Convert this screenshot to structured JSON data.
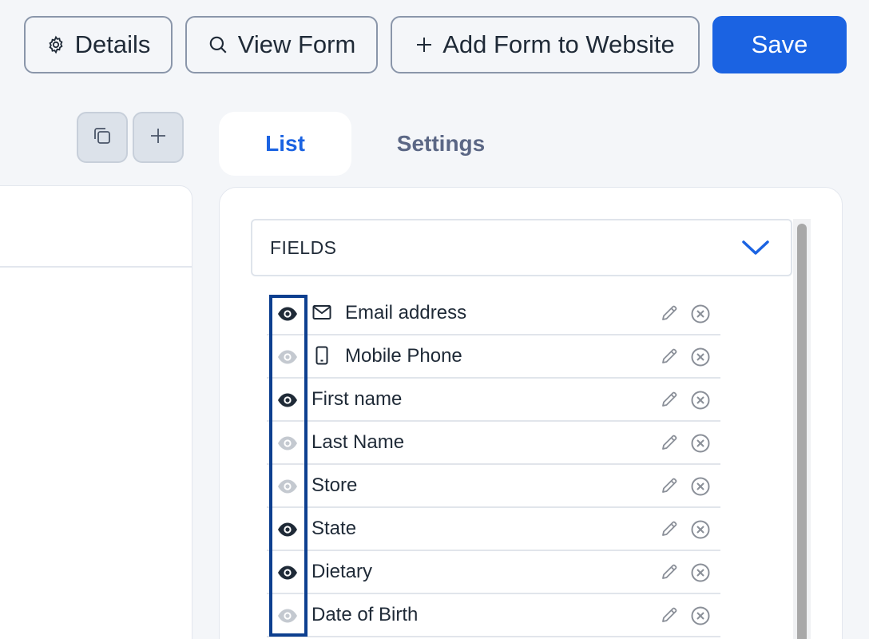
{
  "toolbar": {
    "details_label": "Details",
    "view_form_label": "View Form",
    "add_form_label": "Add Form to Website",
    "save_label": "Save"
  },
  "tabs": [
    {
      "label": "List",
      "active": true
    },
    {
      "label": "Settings",
      "active": false
    }
  ],
  "dropdown": {
    "label": "FIELDS"
  },
  "fields": [
    {
      "label": "Email address",
      "visible": true,
      "icon": "mail-icon"
    },
    {
      "label": "Mobile Phone",
      "visible": false,
      "icon": "phone-icon"
    },
    {
      "label": "First name",
      "visible": true
    },
    {
      "label": "Last Name",
      "visible": false
    },
    {
      "label": "Store",
      "visible": false
    },
    {
      "label": "State",
      "visible": true
    },
    {
      "label": "Dietary",
      "visible": true
    },
    {
      "label": "Date of Birth",
      "visible": false
    }
  ],
  "colors": {
    "accent": "#1b63e2",
    "eye_visible": "#1f2a37",
    "eye_hidden": "#c4c9d0",
    "highlight": "#0d3f8f"
  }
}
